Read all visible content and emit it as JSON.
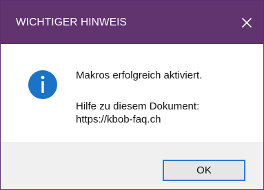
{
  "dialog": {
    "title": "WICHTIGER HINWEIS",
    "close_icon": "close-icon",
    "info_icon": "info-icon",
    "message_main": "Makros erfolgreich aktiviert.",
    "message_help": "Hilfe zu diesem Dokument:",
    "message_url": "https://kbob-faq.ch",
    "ok_label": "OK"
  },
  "colors": {
    "titlebar": "#61336f",
    "titlebar_text": "#ffffff",
    "content_background": "#ffffff",
    "footer_background": "#f0f0f0",
    "info_icon": "#1b73c7",
    "button_focus_border": "#2f78d3"
  }
}
